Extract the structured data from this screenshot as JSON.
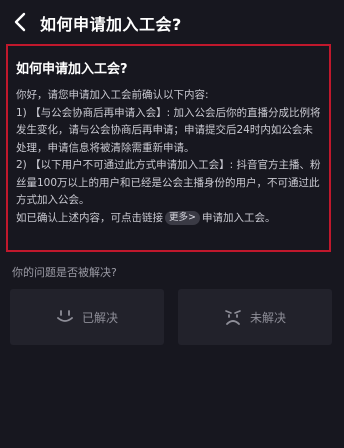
{
  "header": {
    "title": "如何申请加入工会?"
  },
  "article": {
    "title": "如何申请加入工会?",
    "lines": [
      "你好，请您申请加入工会前确认以下内容:",
      "1)  【与公会协商后再申请入会】: 加入公会后你的直播分成比例将发生变化，请与公会协商后再申请；申请提交后24时内如公会未处理，申请信息将被清除需重新申请。",
      "2)  【以下用户不可通过此方式申请加入工会】: 抖音官方主播、粉丝量100万以上的用户和已经是公会主播身份的用户，不可通过此方式加入公会。"
    ],
    "confirm_prefix": "如已确认上述内容，可点击链接",
    "more_label": "更多>",
    "confirm_suffix": "申请加入工会。"
  },
  "feedback": {
    "question": "你的问题是否被解决?",
    "solved_label": "已解决",
    "unsolved_label": "未解决",
    "solved_icon": "smile-face-icon",
    "unsolved_icon": "sad-face-icon"
  }
}
